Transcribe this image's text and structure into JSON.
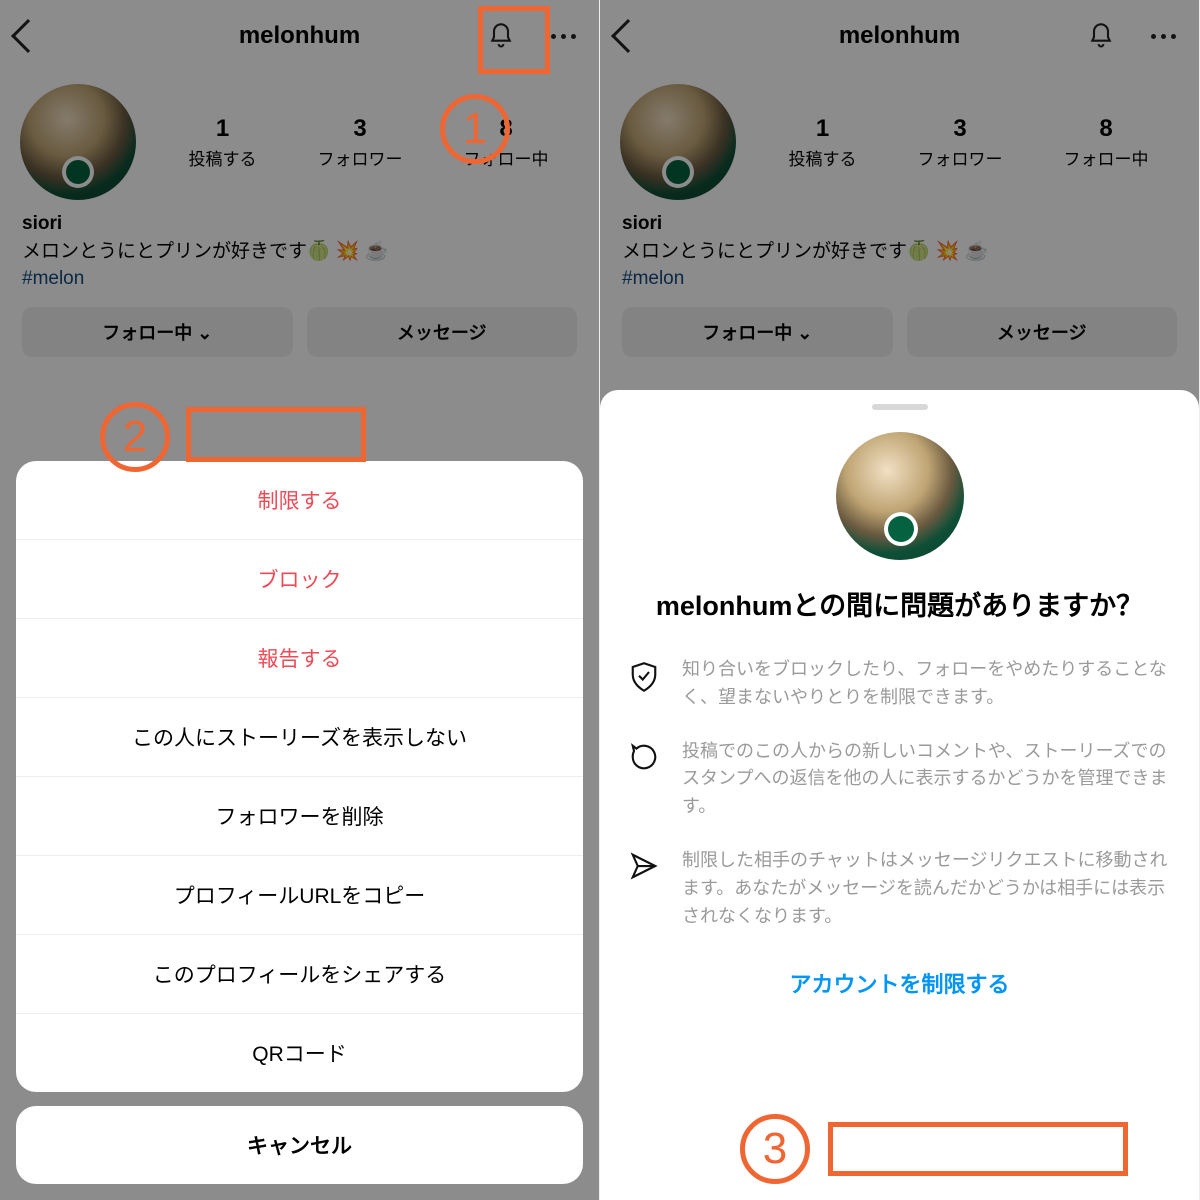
{
  "left": {
    "header": {
      "title": "melonhum"
    },
    "profile": {
      "stats": [
        {
          "n": "1",
          "l": "投稿する"
        },
        {
          "n": "3",
          "l": "フォロワー"
        },
        {
          "n": "8",
          "l": "フォロー中"
        }
      ],
      "name": "siori",
      "bio": "メロンとうにとプリンが好きです🍈 💥 ☕️",
      "hashtag": "#melon"
    },
    "buttons": {
      "follow": "フォロー中 ⌄",
      "message": "メッセージ"
    },
    "sheet": {
      "restrict": "制限する",
      "block": "ブロック",
      "report": "報告する",
      "hide_story": "この人にストーリーズを表示しない",
      "remove_follower": "フォロワーを削除",
      "copy_url": "プロフィールURLをコピー",
      "share_profile": "このプロフィールをシェアする",
      "qr": "QRコード",
      "cancel": "キャンセル"
    },
    "anno": {
      "one": "1",
      "two": "2"
    }
  },
  "right": {
    "header": {
      "title": "melonhum"
    },
    "profile": {
      "stats": [
        {
          "n": "1",
          "l": "投稿する"
        },
        {
          "n": "3",
          "l": "フォロワー"
        },
        {
          "n": "8",
          "l": "フォロー中"
        }
      ],
      "name": "siori",
      "bio": "メロンとうにとプリンが好きです🍈 💥 ☕️",
      "hashtag": "#melon"
    },
    "buttons": {
      "follow": "フォロー中 ⌄",
      "message": "メッセージ"
    },
    "panel": {
      "title": "melonhumとの間に問題がありますか？",
      "info1": "知り合いをブロックしたり、フォローをやめたりすることなく、望まないやりとりを制限できます。",
      "info2": "投稿でのこの人からの新しいコメントや、ストーリーズでのスタンプへの返信を他の人に表示するかどうかを管理できます。",
      "info3": "制限した相手のチャットはメッセージリクエストに移動されます。あなたがメッセージを読んだかどうかは相手には表示されなくなります。",
      "cta": "アカウントを制限する"
    },
    "anno": {
      "three": "3"
    }
  }
}
